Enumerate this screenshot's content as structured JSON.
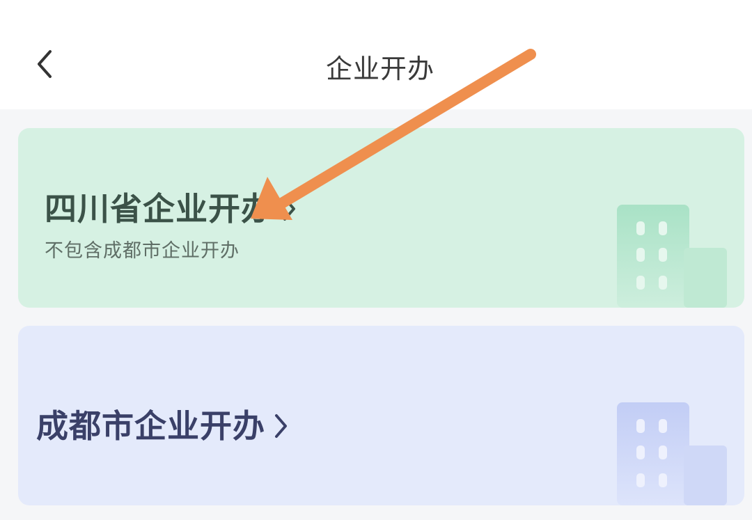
{
  "header": {
    "title": "企业开办",
    "back_icon": "chevron-left-icon"
  },
  "cards": [
    {
      "title": "四川省企业开办",
      "subtitle": "不包含成都市企业开办",
      "chevron_icon": "chevron-right-icon",
      "illustration": "building-icon",
      "background_color": "#d6f1e3",
      "accent_color": "#a9e2c6"
    },
    {
      "title": "成都市企业开办",
      "chevron_icon": "chevron-right-icon",
      "illustration": "building-icon",
      "background_color": "#e4eafb",
      "accent_color": "#c2cdf5"
    }
  ],
  "annotation": {
    "arrow_color": "#ef8f4e"
  }
}
